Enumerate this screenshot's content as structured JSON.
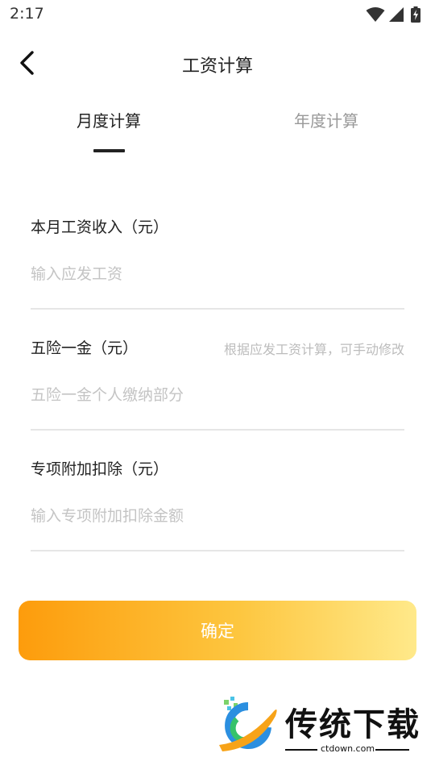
{
  "status_bar": {
    "time": "2:17",
    "icons": [
      "wifi-icon",
      "signal-icon",
      "battery-charging-icon"
    ]
  },
  "nav": {
    "title": "工资计算",
    "back_icon": "chevron-left-icon"
  },
  "tabs": [
    {
      "label": "月度计算",
      "active": true
    },
    {
      "label": "年度计算",
      "active": false
    }
  ],
  "form": {
    "salary": {
      "label": "本月工资收入（元）",
      "placeholder": "输入应发工资",
      "value": ""
    },
    "insurance": {
      "label": "五险一金（元）",
      "hint": "根据应发工资计算，可手动修改",
      "placeholder": "五险一金个人缴纳部分",
      "value": ""
    },
    "deduction": {
      "label": "专项附加扣除（元）",
      "placeholder": "输入专项附加扣除金额",
      "value": ""
    }
  },
  "confirm_label": "确定",
  "watermark": {
    "brand_text": "传统下载",
    "url": "ctdown.com"
  },
  "colors": {
    "button_gradient_start": "#fd9c0c",
    "button_gradient_end": "#ffe98a",
    "tab_active": "#222222",
    "tab_inactive": "#999999",
    "placeholder": "#c4c4c4"
  }
}
